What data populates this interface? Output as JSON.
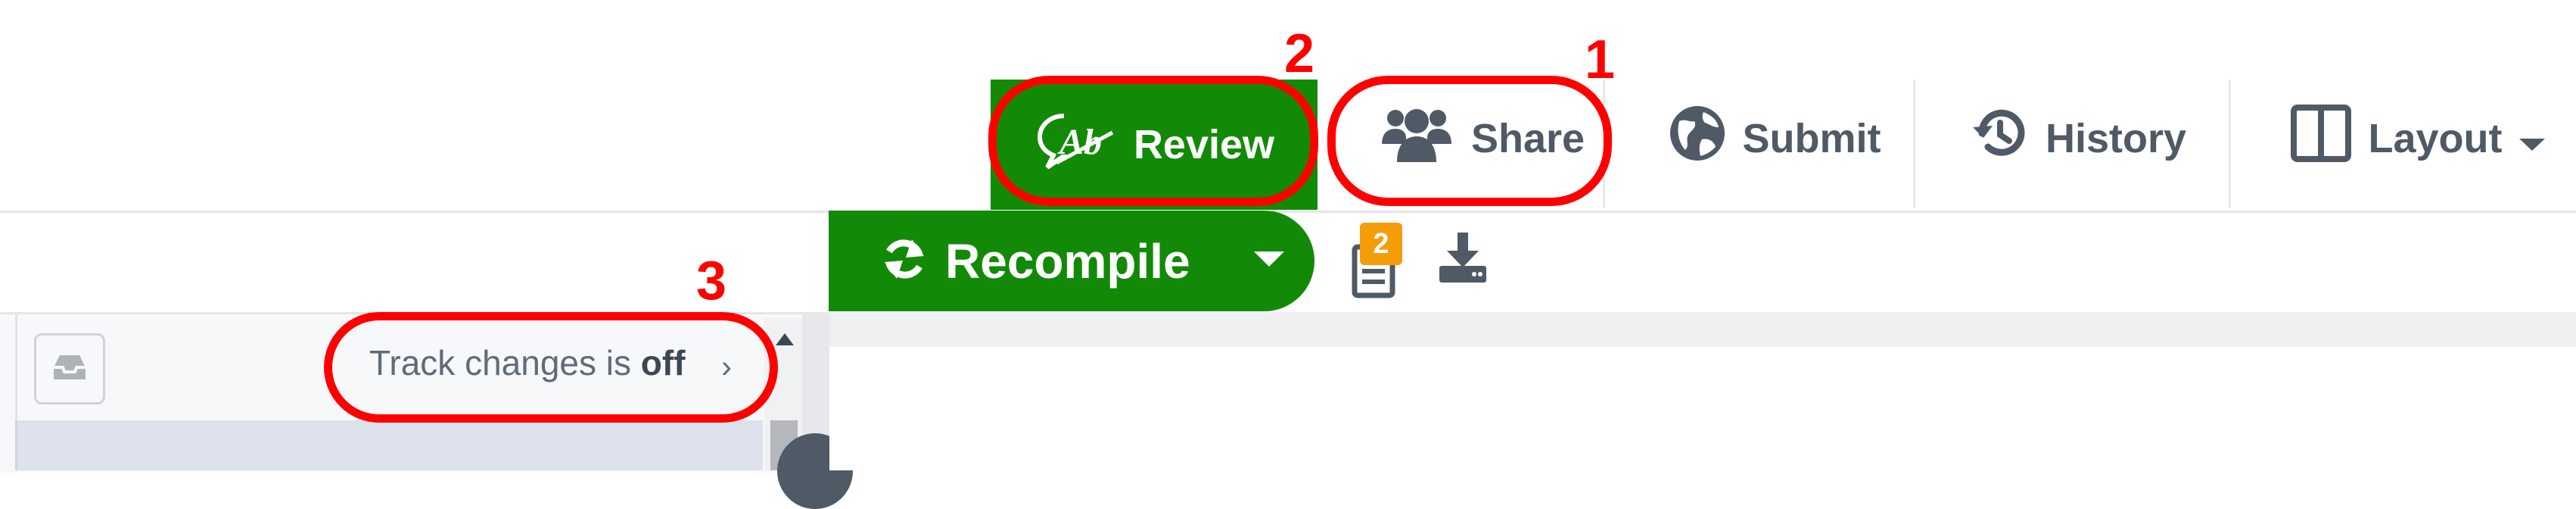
{
  "toolbar": {
    "review_label": "Review",
    "share_label": "Share",
    "submit_label": "Submit",
    "history_label": "History",
    "layout_label": "Layout"
  },
  "pdf_toolbar": {
    "recompile_label": "Recompile",
    "logs_badge_count": "2"
  },
  "review_panel": {
    "track_changes_prefix": "Track changes is ",
    "track_changes_state": "off",
    "chevron": "›"
  },
  "annotations": {
    "share_number": "1",
    "review_number": "2",
    "track_changes_number": "3",
    "color": "#ff0000"
  },
  "colors": {
    "accent_green": "#138a07",
    "badge_orange": "#f59d09",
    "toolbar_text": "#505a66"
  },
  "icons": {
    "review": "review-icon",
    "share": "users-icon",
    "submit": "globe-icon",
    "history": "history-icon",
    "layout": "layout-columns-icon",
    "recompile": "refresh-icon",
    "logs": "document-icon",
    "download": "download-icon",
    "inbox": "inbox-icon"
  }
}
